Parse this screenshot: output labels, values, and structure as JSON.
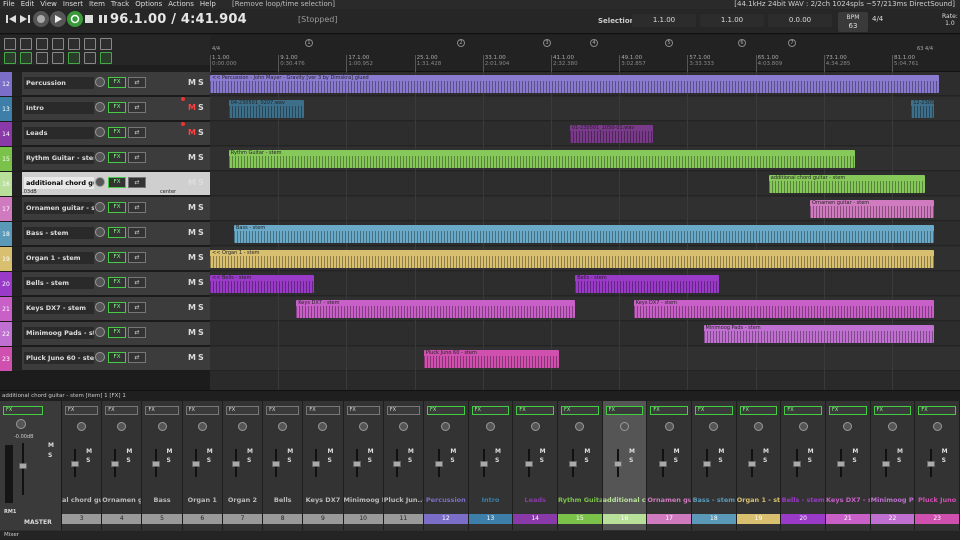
{
  "menu": {
    "items": [
      "File",
      "Edit",
      "View",
      "Insert",
      "Item",
      "Track",
      "Options",
      "Actions",
      "Help"
    ],
    "undo_hint": "[Remove loop/time selection]",
    "audio_info": "[44.1kHz 24bit WAV : 2/2ch 1024spls ~57/213ms DirectSound]"
  },
  "transport": {
    "timecode": "96.1.00 / 4:41.904",
    "status": "[Stopped]",
    "selection_label": "Selection:",
    "sel_start": "1.1.00",
    "sel_end": "1.1.00",
    "sel_length": "0.0.00",
    "bpm_label": "BPM",
    "bpm_value": "63",
    "time_signature": "4/4",
    "rate_label": "Rate:",
    "rate_value": "1.0"
  },
  "ruler": {
    "left_sig": "4/4",
    "right_sig": "63 4/4",
    "markers": [
      "1",
      "2",
      "3",
      "4",
      "5",
      "6",
      "7"
    ],
    "labels": [
      {
        "bar": "1.1.00",
        "time": "0:00.000"
      },
      {
        "bar": "9.1.00",
        "time": "0:30.476"
      },
      {
        "bar": "17.1.00",
        "time": "1:00.952"
      },
      {
        "bar": "25.1.00",
        "time": "1:31.428"
      },
      {
        "bar": "33.1.00",
        "time": "2:01.904"
      },
      {
        "bar": "41.1.00",
        "time": "2:32.380"
      },
      {
        "bar": "49.1.00",
        "time": "3:02.857"
      },
      {
        "bar": "57.1.00",
        "time": "3:33.333"
      },
      {
        "bar": "65.1.00",
        "time": "4:03.809"
      },
      {
        "bar": "73.1.00",
        "time": "4:34.285"
      },
      {
        "bar": "81.1.00",
        "time": "5:04.761"
      },
      {
        "bar": "89.1.00",
        "time": "5:35.238"
      }
    ]
  },
  "tracks": [
    {
      "num": "12",
      "name": "Percussion",
      "color": "#7b6ec8",
      "mute": false,
      "armed": false
    },
    {
      "num": "13",
      "name": "Intro",
      "color": "#3d7fa8",
      "mute": true,
      "armed": true
    },
    {
      "num": "14",
      "name": "Leads",
      "color": "#8a3aa8",
      "mute": true,
      "armed": true
    },
    {
      "num": "15",
      "name": "Rythm Guitar - stem",
      "color": "#7bc24a",
      "mute": false,
      "armed": false
    },
    {
      "num": "16",
      "name": "additional chord guitar",
      "color": "#b8e09a",
      "mute": false,
      "armed": false,
      "selected": true,
      "volume": "-10.03dB",
      "pan": "center"
    },
    {
      "num": "17",
      "name": "Ornamen guitar - stem",
      "color": "#d07ac0",
      "mute": false,
      "armed": false
    },
    {
      "num": "18",
      "name": "Bass - stem",
      "color": "#5a9ab8",
      "mute": false,
      "armed": false
    },
    {
      "num": "19",
      "name": "Organ 1 - stem",
      "color": "#d8c070",
      "mute": false,
      "armed": false
    },
    {
      "num": "20",
      "name": "Bells - stem",
      "color": "#9a3ac8",
      "mute": false,
      "armed": false
    },
    {
      "num": "21",
      "name": "Keys DX7 - stem",
      "color": "#c860c8",
      "mute": false,
      "armed": false
    },
    {
      "num": "22",
      "name": "Minimoog Pads - stem",
      "color": "#c070d0",
      "mute": false,
      "armed": false
    },
    {
      "num": "23",
      "name": "Pluck Juno 60 - stem",
      "color": "#d050b0",
      "mute": false,
      "armed": false
    }
  ],
  "tcp_labels": {
    "fx": "FX",
    "mute": "M",
    "solo": "S"
  },
  "items": [
    {
      "lane": 0,
      "label": "<< Percussion - John Mayer - Gravity [ver 3 by Dimskra] glued",
      "start": 0.0,
      "end": 0.972,
      "color": "#8a7bd0"
    },
    {
      "lane": 1,
      "label": "04-230501_0207.wav",
      "start": 0.025,
      "end": 0.125,
      "color": "#3d6f8a"
    },
    {
      "lane": 1,
      "label": "12-2305",
      "start": 0.935,
      "end": 0.965,
      "color": "#3d6f8a"
    },
    {
      "lane": 2,
      "label": "01-230501_1050-01.wav",
      "start": 0.48,
      "end": 0.59,
      "color": "#7a3a8a"
    },
    {
      "lane": 3,
      "label": "Rythm Guitar - stem",
      "start": 0.025,
      "end": 0.86,
      "color": "#86c95a"
    },
    {
      "lane": 4,
      "label": "additional chord guitar - stem",
      "start": 0.745,
      "end": 0.953,
      "color": "#86c95a"
    },
    {
      "lane": 5,
      "label": "Ornamen guitar - stem",
      "start": 0.8,
      "end": 0.965,
      "color": "#d07ac0"
    },
    {
      "lane": 6,
      "label": "Bass - stem",
      "start": 0.032,
      "end": 0.965,
      "color": "#6aaac8"
    },
    {
      "lane": 7,
      "label": "<< Organ 1 - stem",
      "start": 0.0,
      "end": 0.965,
      "color": "#d8c070"
    },
    {
      "lane": 8,
      "label": "<< Bells - stem",
      "start": 0.0,
      "end": 0.138,
      "color": "#9a3ac8"
    },
    {
      "lane": 8,
      "label": "Bells - stem",
      "start": 0.487,
      "end": 0.678,
      "color": "#9a3ac8"
    },
    {
      "lane": 9,
      "label": "Keys DX7 - stem",
      "start": 0.115,
      "end": 0.487,
      "color": "#c860c8"
    },
    {
      "lane": 9,
      "label": "Keys DX7 - stem",
      "start": 0.565,
      "end": 0.965,
      "color": "#c860c8"
    },
    {
      "lane": 10,
      "label": "Minimoog Pads - stem",
      "start": 0.658,
      "end": 0.965,
      "color": "#c070d0"
    },
    {
      "lane": 11,
      "label": "Pluck Juno 60 - stem",
      "start": 0.285,
      "end": 0.465,
      "color": "#d050b0"
    }
  ],
  "statusline": "additional chord guitar - stem [item] 1 [FX] 1",
  "mixer": {
    "master_label": "MASTER",
    "master_rm": "RM1",
    "master_volume": "-0.00dB",
    "folder_strips": [
      {
        "name": "al chord gui",
        "num": "3"
      },
      {
        "name": "Ornamen gui",
        "num": "4"
      },
      {
        "name": "Bass",
        "num": "5"
      },
      {
        "name": "Organ 1",
        "num": "6"
      },
      {
        "name": "Organ 2",
        "num": "7"
      },
      {
        "name": "Bells",
        "num": "8"
      },
      {
        "name": "Keys DX7",
        "num": "9"
      },
      {
        "name": "Minimoog Pa",
        "num": "10"
      },
      {
        "name": "Pluck Jun..60",
        "num": "11"
      }
    ],
    "track_strips": [
      {
        "name": "Percussion",
        "num": "12",
        "color": "#7b6ec8"
      },
      {
        "name": "Intro",
        "num": "13",
        "color": "#3d7fa8"
      },
      {
        "name": "Leads",
        "num": "14",
        "color": "#8a3aa8"
      },
      {
        "name": "Rythm Guitar",
        "num": "15",
        "color": "#7bc24a"
      },
      {
        "name": "additional ch",
        "num": "16",
        "color": "#b8e09a",
        "selected": true
      },
      {
        "name": "Ornamen gui",
        "num": "17",
        "color": "#d07ac0"
      },
      {
        "name": "Bass - stem",
        "num": "18",
        "color": "#5a9ab8"
      },
      {
        "name": "Organ 1 - st",
        "num": "19",
        "color": "#d8c070"
      },
      {
        "name": "Bells - stem",
        "num": "20",
        "color": "#9a3ac8"
      },
      {
        "name": "Keys DX7 - st",
        "num": "21",
        "color": "#c860c8"
      },
      {
        "name": "Minimoog Pa",
        "num": "22",
        "color": "#c070d0"
      },
      {
        "name": "Pluck Juno",
        "num": "23",
        "color": "#d050b0"
      }
    ],
    "tab_label": "Mixer"
  }
}
